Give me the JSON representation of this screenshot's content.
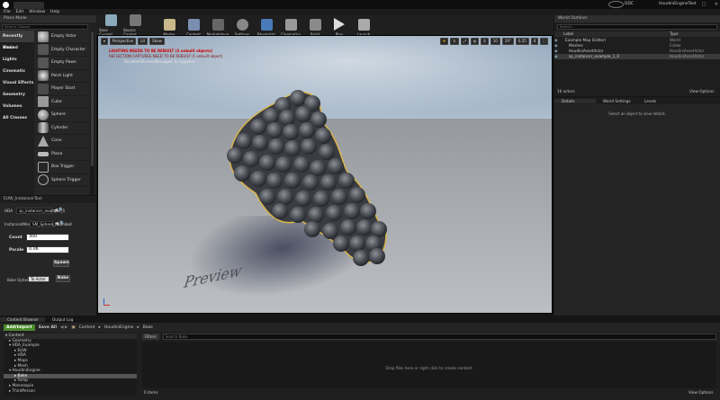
{
  "window": {
    "icon_label": "UE",
    "tab_title": "",
    "project": "HoudiniEngineTest"
  },
  "menu": [
    "File",
    "Edit",
    "Window",
    "Help"
  ],
  "modes": {
    "tab": "Place Mode",
    "search_placeholder": "Search Classes"
  },
  "categories": [
    "Recently Placed",
    "Basic",
    "Lights",
    "Cinematic",
    "Visual Effects",
    "Geometry",
    "Volumes",
    "All Classes"
  ],
  "assets": [
    "Empty Actor",
    "Empty Character",
    "Empty Pawn",
    "Point Light",
    "Player Start",
    "Cube",
    "Sphere",
    "Cylinder",
    "Cone",
    "Plane",
    "Box Trigger",
    "Sphere Trigger"
  ],
  "toolbar": [
    "Save Current",
    "Source Control",
    "Modes",
    "Content",
    "Marketplace",
    "Settings",
    "Blueprints",
    "Cinematics",
    "Build",
    "Play",
    "Launch"
  ],
  "viewport": {
    "view_mode": "Perspective",
    "lit": "Lit",
    "show": "Show",
    "warning_line1": "LIGHTING NEEDS TO BE REBUILT (3 unbuilt objects)",
    "warning_line2": "REFLECTION CAPTURES NEED TO BE REBUILT (1 unbuilt object)",
    "warning_line3": "'DisableAllScreenMessages' to suppress",
    "grid_snap": "10",
    "rot_snap": "10°",
    "scale_snap": "0.25",
    "cam_speed": "4",
    "preview_text": "Preview"
  },
  "details_panel": {
    "tab": "EUW_InstancerTool",
    "hda_label": "HDA",
    "hda_value": "sp_instancer_example_1",
    "instance_mesh_label": "InstancedMesh",
    "instance_mesh_value": "SM_Sphere_Rounded",
    "count_label": "Count",
    "count_value": "300",
    "pscale_label": "Pscale",
    "pscale_value": "0.06",
    "spawn_button": "Spawn",
    "bake_option_label": "Bake Option",
    "bake_option_value": "To Actor",
    "bake_button": "Bake"
  },
  "world_outliner": {
    "tab": "World Outliner",
    "search_placeholder": "Search...",
    "col_label": "Label",
    "col_type": "Type",
    "rows": [
      {
        "label": "Example Map (Editor)",
        "type": "World"
      },
      {
        "label": "Meshes",
        "type": "Folder"
      },
      {
        "label": "HoudiniAssetActor",
        "type": "HoudiniAssetActor"
      },
      {
        "label": "sp_instancer_example_1_0",
        "type": "HoudiniAssetActor"
      }
    ],
    "actor_count": "16 actors",
    "view_options": "View Options"
  },
  "details_tabs": {
    "tab1": "Details",
    "tab2": "World Settings",
    "tab3": "Levels",
    "empty_text": "Select an object to view details."
  },
  "content_browser": {
    "tab1": "Content Browser",
    "tab2": "Output Log",
    "add_new": "Add/Import",
    "save_all": "Save All",
    "path": [
      "Content",
      "HoudiniEngine",
      "Bake"
    ],
    "filters": "Filters",
    "search_placeholder": "Search Bake",
    "drop_text": "Drop files here or right click to create content.",
    "items_count": "0 items",
    "view_options": "View Options",
    "tree": [
      "Content",
      "Geometry",
      "HDA_Example",
      "EUW",
      "HDA",
      "Maps",
      "Mesh",
      "HoudiniEngine",
      "Bake",
      "Temp",
      "Mannequin",
      "ThirdPerson"
    ]
  },
  "status_tray": {
    "label": "DDC"
  }
}
